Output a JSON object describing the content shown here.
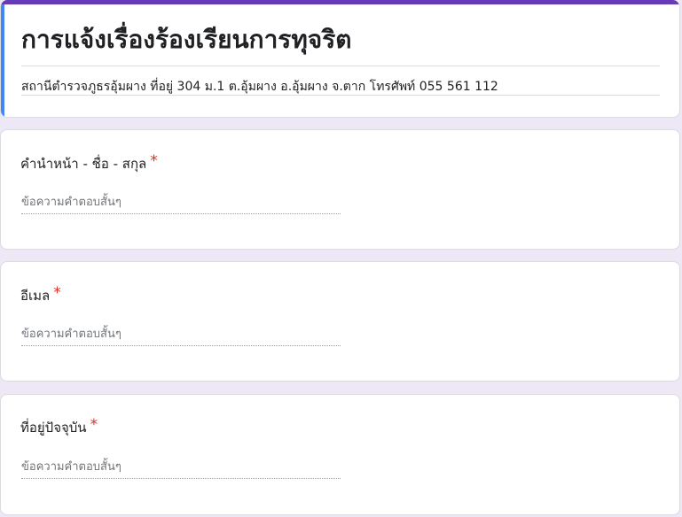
{
  "form": {
    "title": "การแจ้งเรื่องร้องเรียนการทุจริต",
    "description": "สถานีตำรวจภูธรอุ้มผาง ที่อยู่ 304 ม.1 ต.อุ้มผาง อ.อุ้มผาง จ.ตาก โทรศัพท์ 055 561 112"
  },
  "questions": [
    {
      "label": "คำนำหน้า - ชื่อ - สกุล",
      "required_mark": "*",
      "placeholder": "ข้อความคำตอบสั้นๆ",
      "value": ""
    },
    {
      "label": "อีเมล",
      "required_mark": "*",
      "placeholder": "ข้อความคำตอบสั้นๆ",
      "value": ""
    },
    {
      "label": "ที่อยู่ปัจจุบัน",
      "required_mark": "*",
      "placeholder": "ข้อความคำตอบสั้นๆ",
      "value": ""
    }
  ],
  "colors": {
    "page_background": "#ede7f6",
    "header_band": "#673ab7",
    "active_accent": "#4285f4",
    "required": "#d93025"
  }
}
